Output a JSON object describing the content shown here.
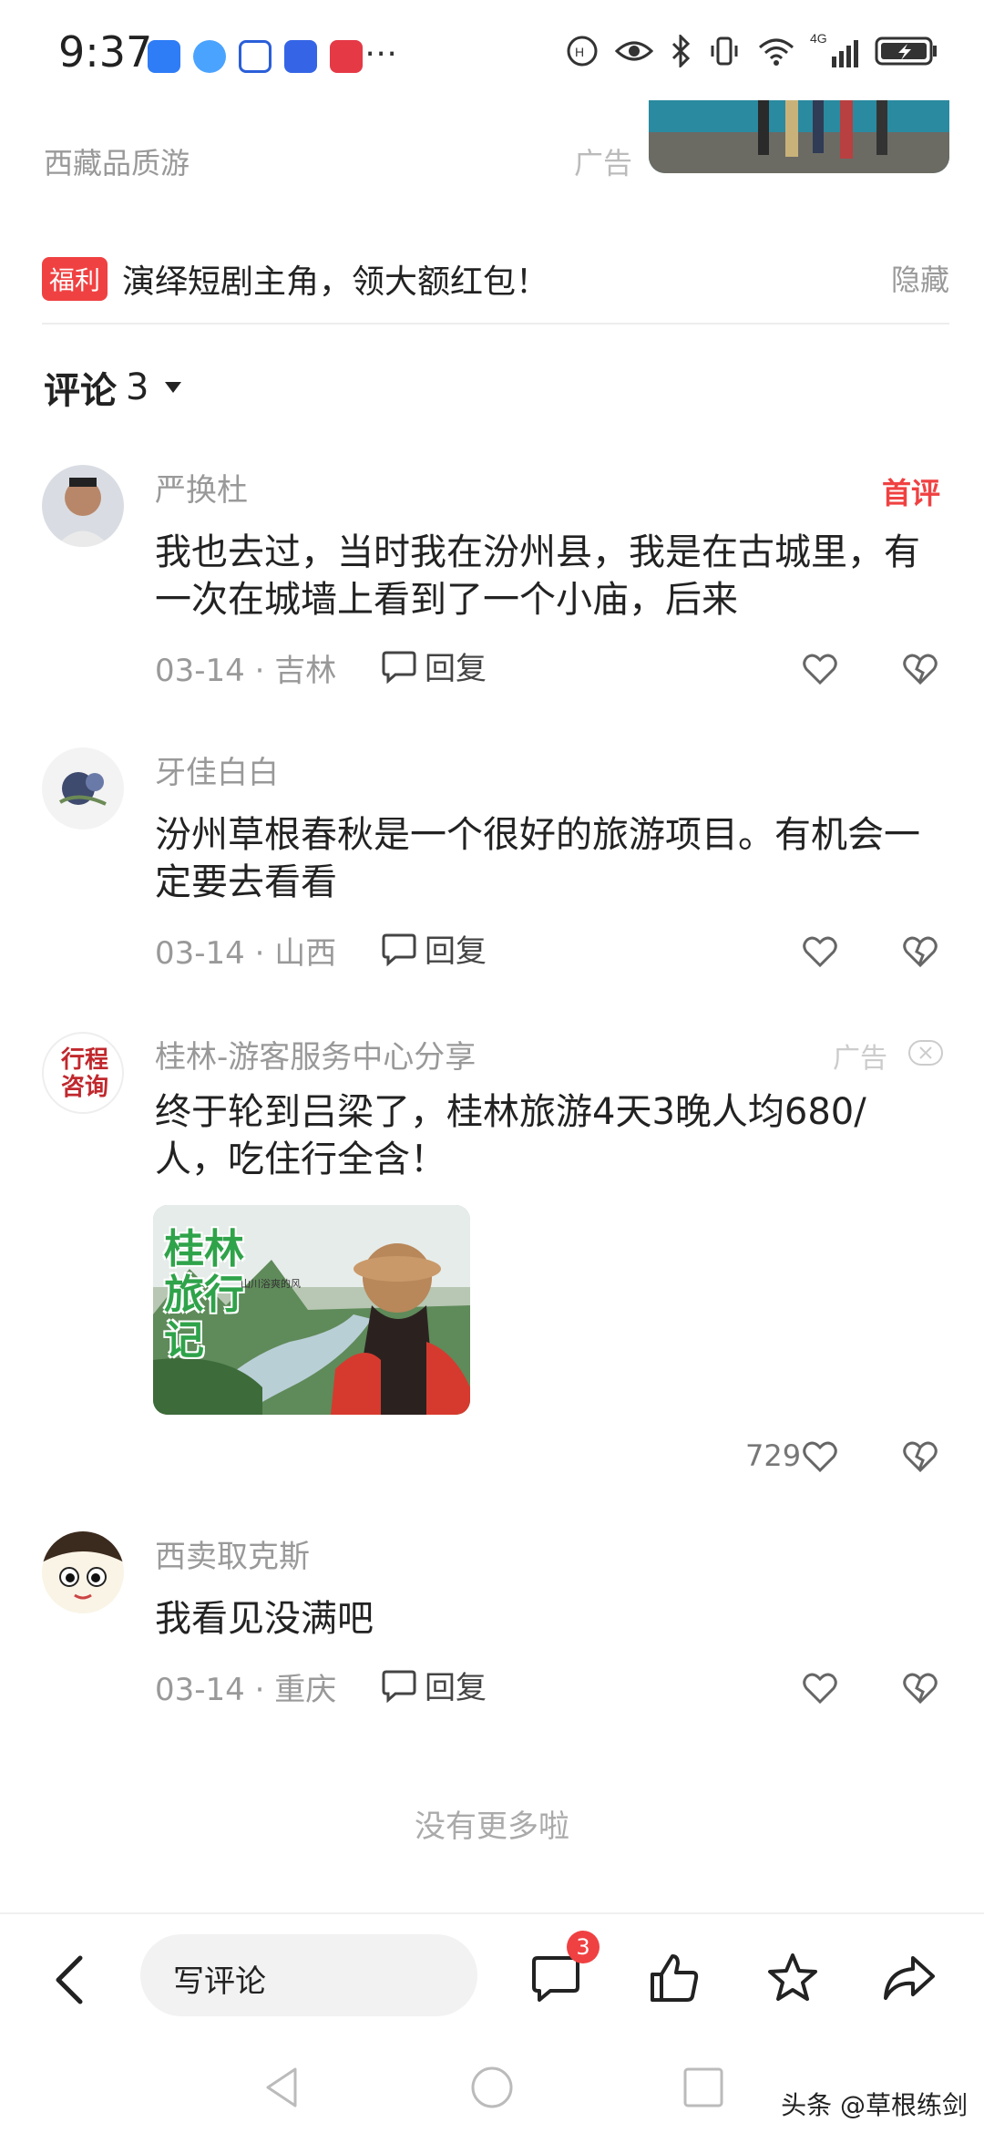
{
  "status_bar": {
    "time": "9:37",
    "overflow": "⋯",
    "network": "4G"
  },
  "top_ad": {
    "source": "西藏品质游",
    "label": "广告"
  },
  "promo": {
    "badge": "福利",
    "text": "演绎短剧主角，领大额红包！",
    "hide": "隐藏"
  },
  "comments_header": {
    "title": "评论",
    "count": "3"
  },
  "comments": [
    {
      "user": "严换杜",
      "badge": "首评",
      "text": "我也去过，当时我在汾州县，我是在古城里，有一次在城墙上看到了一个小庙，后来",
      "meta": "03-14 · 吉林",
      "reply": "回复"
    },
    {
      "user": "牙佳白白",
      "text": "汾州草根春秋是一个很好的旅游项目。有机会一定要去看看",
      "meta": "03-14 · 山西",
      "reply": "回复"
    },
    {
      "user": "桂林-游客服务中心分享",
      "ad_label": "广告",
      "avatar_text": "行程咨询",
      "text": "终于轮到吕梁了，桂林旅游4天3晚人均680/人，吃住行全含！",
      "image_title": "桂林旅行记",
      "image_subtitle": "山川浴爽的风",
      "likes": "729"
    },
    {
      "user": "西卖取克斯",
      "text": "我看见没满吧",
      "meta": "03-14 · 重庆",
      "reply": "回复"
    }
  ],
  "no_more": "没有更多啦",
  "action_bar": {
    "write_comment": "写评论",
    "comment_badge": "3"
  },
  "watermark": "头条 @草根练剑",
  "colors": {
    "accent": "#f04142",
    "muted": "#999999",
    "text": "#222222"
  }
}
